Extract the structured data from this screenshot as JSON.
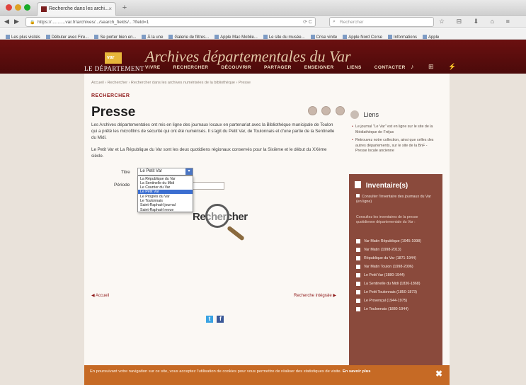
{
  "browser": {
    "tab_title": "Recherche dans les archi...",
    "tab_close": "×",
    "new_tab": "+",
    "url": "https://...........var.fr/archives/.../search_fields/...?field=1",
    "url_right": "⟳  C",
    "search_placeholder": "Rechercher",
    "back": "◀",
    "forward": "▶",
    "toolbar_icons": "☆ ⊟ ⬇ ⌂ ≡",
    "bookmarks": [
      "Les plus visités",
      "Débuter avec Fire...",
      "Se porter bien en...",
      "À la une",
      "Galerie de filtres...",
      "Apple Mac Mobile...",
      "Le site du musée...",
      "Crise vinite",
      "Apple Nord Corse",
      "Informations",
      "Apple"
    ]
  },
  "site": {
    "logo_box": "var",
    "logo_text": "LE DÉPARTEMENT",
    "title": "Archives départementales du Var",
    "nav": [
      "VIVRE",
      "RECHERCHER",
      "DÉCOUVRIR",
      "PARTAGER",
      "ENSEIGNER",
      "LIENS",
      "CONTACTER"
    ],
    "nav_icons": "♪ ⊞ ⚡"
  },
  "main": {
    "breadcrumb": "Accueil › Rechercher › Rechercher dans les archives numérisées de la bibliothèque › Presse",
    "section_label": "RECHERCHER",
    "title": "Presse",
    "para1": "Les Archives départementales ont mis en ligne des journaux locaux en partenariat avec la Bibliothèque municipale de Toulon qui a prêté les microfilms de sécurité qui ont été numérisés. Il s'agit du Petit Var, de Toulonnais et d'une partie de la Sentinelle du Midi.",
    "para2": "Le Petit Var et La République du Var sont les deux quotidiens régionaux conservés pour la Sixième et le début du XXème siècle.",
    "form": {
      "titre_label": "Titre",
      "periode_label": "Période",
      "selected_value": "Le Petit Var",
      "options": [
        "La République du Var",
        "La Sentinelle du Midi",
        "Le Courrier du Var",
        "Le Petit Var",
        "Le Progrès du Var",
        "Le Toulonnais",
        "Saint-Raphaël journal",
        "Saint-Raphaël revue"
      ],
      "selected_index": 3
    },
    "search_graphic_text": "Rechercher",
    "prev_link": "◀ Accueil",
    "next_link": "Recherche intégrale ▶",
    "social": [
      "t",
      "f"
    ]
  },
  "sidebar": {
    "liens_title": "Liens",
    "liens": [
      "Le journal \"Le Var\" est en ligne sur le site de la Médiathèque de Fréjus",
      "Retrouvez notre collection, ainsi que celles des autres départements, sur le site de la BnF - Presse locale ancienne"
    ],
    "inventaire_title": "Inventaire(s)",
    "inventaire_intro": "Consulter l'inventaire des journaux du Var ",
    "inventaire_intro_link": "(en ligne)",
    "inventaire_desc": "Consultez les inventaires de la presse quotidienne départementale du Var :",
    "inventaire_items": [
      "Var Matin République (1945-1998)",
      "Var Matin (1998-2013)",
      "République du Var (1871-1944)",
      "Var Matin Toulon (1998-2006)",
      "Le Petit Var (1880-1944)",
      "La Sentinelle du Midi (1836-1868)",
      "Le Petit Toulonnais (1850-1873)",
      "Le Provençal (1944-1975)",
      "Le Toulonnais (1880-1944)"
    ]
  },
  "cookie": {
    "text": "En poursuivant votre navigation sur ce site, vous acceptez l'utilisation de cookies pour vous permettre de réaliser des statistiques de visite. ",
    "more": "En savoir plus",
    "close": "✖"
  }
}
